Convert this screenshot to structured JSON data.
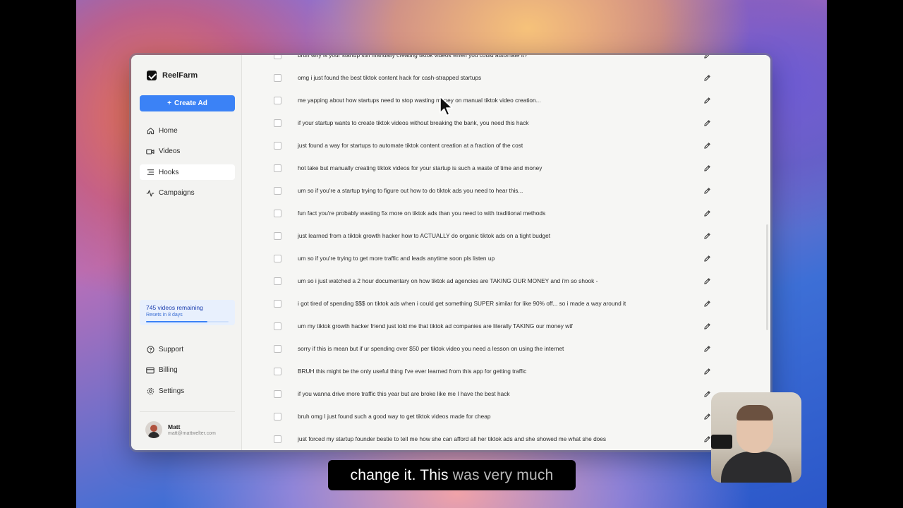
{
  "app": {
    "name": "ReelFarm"
  },
  "sidebar": {
    "create_label": "Create Ad",
    "nav": [
      {
        "label": "Home",
        "icon": "home-icon"
      },
      {
        "label": "Videos",
        "icon": "video-icon"
      },
      {
        "label": "Hooks",
        "icon": "list-icon",
        "active": true
      },
      {
        "label": "Campaigns",
        "icon": "activity-icon"
      }
    ],
    "usage": {
      "remaining": "745 videos remaining",
      "resets": "Resets in 8 days",
      "fraction": 0.74
    },
    "bottom_nav": [
      {
        "label": "Support",
        "icon": "help-icon"
      },
      {
        "label": "Billing",
        "icon": "credit-card-icon"
      },
      {
        "label": "Settings",
        "icon": "gear-icon"
      }
    ],
    "user": {
      "name": "Matt",
      "email": "matt@mattwelter.com"
    }
  },
  "hooks": [
    "bruh why is your startup still manually creating tiktok videos when you could automate it?",
    "omg i just found the best tiktok content hack for cash-strapped startups",
    "me yapping about how startups need to stop wasting money on manual tiktok video creation...",
    "if your startup wants to create tiktok videos without breaking the bank, you need this hack",
    "just found a way for startups to automate tiktok content creation at a fraction of the cost",
    "hot take but manually creating tiktok videos for your startup is such a waste of time and money",
    "um so if you're a startup trying to figure out how to do tiktok ads you need to hear this...",
    "fun fact you're probably wasting 5x more on tiktok ads than you need to with traditional methods",
    "just learned from a tiktok growth hacker how to ACTUALLY do organic tiktok ads on a tight budget",
    "um so if you're trying to get more traffic and leads anytime soon pls listen up",
    "um so i just watched a 2 hour documentary on how tiktok ad agencies are TAKING OUR MONEY and i'm so shook -",
    "i got tired of spending $$$ on tiktok ads when i could get something SUPER similar for like 90% off... so i made a way around it",
    "um my tiktok growth hacker friend just told me that tiktok ad companies are literally TAKING our money wtf",
    "sorry if this is mean but if ur spending over $50 per tiktok video you need a lesson on using the internet",
    "BRUH this might be the only useful thing I've ever learned from this app for getting traffic",
    "if you wanna drive more traffic this year but are broke like me I have the best hack",
    "bruh omg I just found such a good way to get tiktok videos made for cheap",
    "just forced my startup founder bestie to tell me how she can afford all her tiktok ads and she showed me what she does"
  ],
  "caption": {
    "spoken": "change it. This",
    "upcoming": " was very much"
  }
}
